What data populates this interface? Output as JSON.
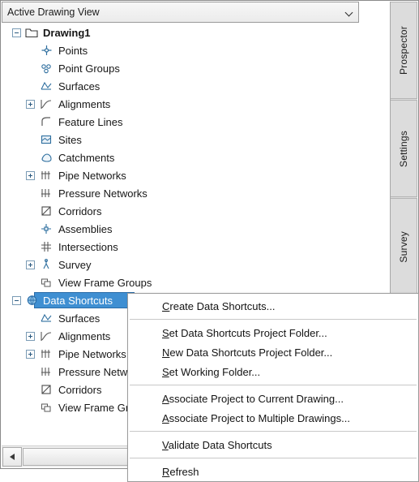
{
  "window": {
    "combo_label": "Active Drawing View"
  },
  "vertical_tabs": [
    {
      "label": "Prospector"
    },
    {
      "label": "Settings"
    },
    {
      "label": "Survey"
    }
  ],
  "tree": {
    "root": {
      "label": "Drawing1",
      "icon": "drawing-icon",
      "expander": "minus"
    },
    "items": [
      {
        "label": "Points",
        "icon": "points-icon",
        "expander": "none",
        "indent": 1
      },
      {
        "label": "Point Groups",
        "icon": "point-groups-icon",
        "expander": "none",
        "indent": 1
      },
      {
        "label": "Surfaces",
        "icon": "surfaces-icon",
        "expander": "none",
        "indent": 1
      },
      {
        "label": "Alignments",
        "icon": "alignments-icon",
        "expander": "plus",
        "indent": 1
      },
      {
        "label": "Feature Lines",
        "icon": "feature-lines-icon",
        "expander": "none",
        "indent": 1
      },
      {
        "label": "Sites",
        "icon": "sites-icon",
        "expander": "none",
        "indent": 1
      },
      {
        "label": "Catchments",
        "icon": "catchments-icon",
        "expander": "none",
        "indent": 1
      },
      {
        "label": "Pipe Networks",
        "icon": "pipe-networks-icon",
        "expander": "plus",
        "indent": 1
      },
      {
        "label": "Pressure Networks",
        "icon": "pressure-networks-icon",
        "expander": "none",
        "indent": 1
      },
      {
        "label": "Corridors",
        "icon": "corridors-icon",
        "expander": "none",
        "indent": 1
      },
      {
        "label": "Assemblies",
        "icon": "assemblies-icon",
        "expander": "none",
        "indent": 1
      },
      {
        "label": "Intersections",
        "icon": "intersections-icon",
        "expander": "none",
        "indent": 1
      },
      {
        "label": "Survey",
        "icon": "survey-icon",
        "expander": "plus",
        "indent": 1
      },
      {
        "label": "View Frame Groups",
        "icon": "view-frame-groups-icon",
        "expander": "none",
        "indent": 1
      }
    ],
    "data_shortcuts": {
      "label": "Data Shortcuts",
      "icon": "data-shortcuts-icon",
      "expander": "minus",
      "selected": true
    },
    "data_shortcut_children": [
      {
        "label": "Surfaces",
        "icon": "surfaces-icon",
        "expander": "none"
      },
      {
        "label": "Alignments",
        "icon": "alignments-icon",
        "expander": "plus"
      },
      {
        "label": "Pipe Networks",
        "icon": "pipe-networks-icon",
        "expander": "plus"
      },
      {
        "label": "Pressure Networks",
        "icon": "pressure-networks-icon",
        "expander": "none"
      },
      {
        "label": "Corridors",
        "icon": "corridors-icon",
        "expander": "none"
      },
      {
        "label": "View Frame Groups",
        "icon": "view-frame-groups-icon",
        "expander": "none"
      }
    ]
  },
  "context_menu": {
    "groups": [
      [
        {
          "label": "Create Data Shortcuts...",
          "mnemonic": "C"
        }
      ],
      [
        {
          "label": "Set Data Shortcuts Project Folder...",
          "mnemonic": "S"
        },
        {
          "label": "New Data Shortcuts Project Folder...",
          "mnemonic": "N"
        },
        {
          "label": "Set Working Folder...",
          "mnemonic": "S"
        }
      ],
      [
        {
          "label": "Associate Project to Current Drawing...",
          "mnemonic": "A"
        },
        {
          "label": "Associate Project to Multiple Drawings...",
          "mnemonic": "A"
        }
      ],
      [
        {
          "label": "Validate Data Shortcuts",
          "mnemonic": "V"
        }
      ],
      [
        {
          "label": "Refresh",
          "mnemonic": "R"
        }
      ]
    ]
  },
  "colors": {
    "selection_blue": "#3f8fd2",
    "icon_blue": "#2f6f9f",
    "icon_gray": "#5a5a5a"
  }
}
